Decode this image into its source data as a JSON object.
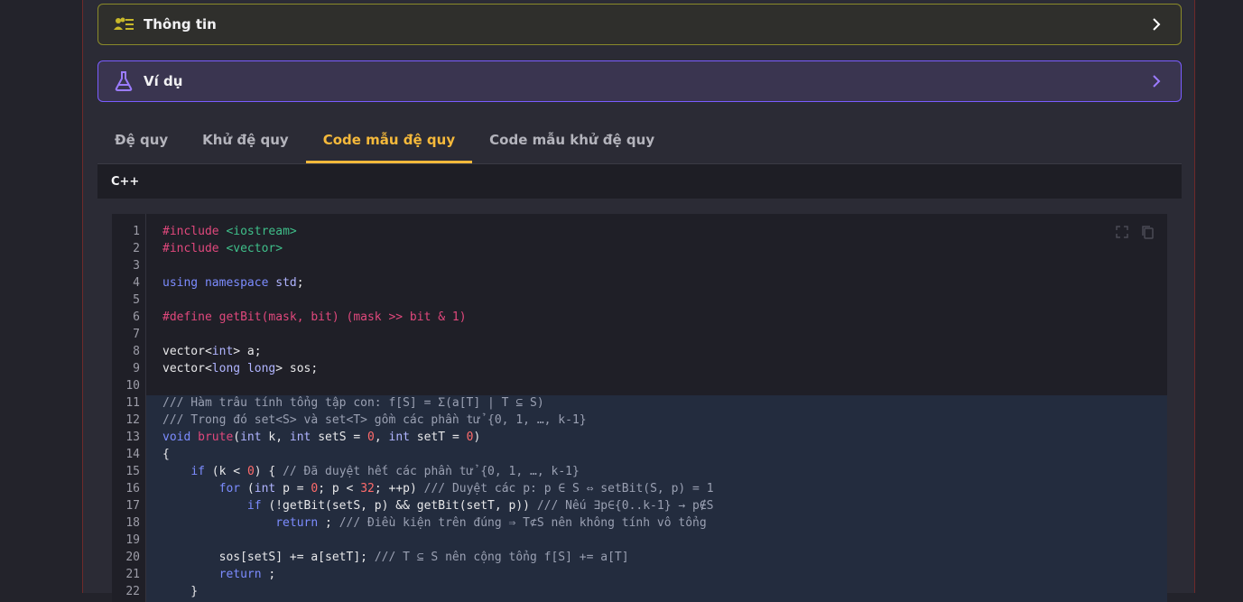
{
  "accordion": {
    "info_title": "Thông tin",
    "example_title": "Ví dụ",
    "info_icon": "users-list-icon",
    "example_icon": "flask-icon"
  },
  "tabs": [
    {
      "label": "Đệ quy",
      "active": false
    },
    {
      "label": "Khử đệ quy",
      "active": false
    },
    {
      "label": "Code mẫu đệ quy",
      "active": true
    },
    {
      "label": "Code mẫu khử đệ quy",
      "active": false
    }
  ],
  "code_language": "C++",
  "code_line_numbers": [
    "1",
    "2",
    "3",
    "4",
    "5",
    "6",
    "7",
    "8",
    "9",
    "10",
    "11",
    "12",
    "13",
    "14",
    "15",
    "16",
    "17",
    "18",
    "19",
    "20",
    "21",
    "22"
  ],
  "code_lines": [
    "#include <iostream>",
    "#include <vector>",
    "",
    "using namespace std;",
    "",
    "#define getBit(mask, bit) (mask >> bit & 1)",
    "",
    "vector<int> a;",
    "vector<long long> sos;",
    "",
    "/// Hàm trâu tính tổng tập con: f[S] = Σ(a[T] | T ⊆ S)",
    "/// Trong đó set<S> và set<T> gồm các phần tử {0, 1, …, k-1}",
    "void brute(int k, int setS = 0, int setT = 0)",
    "{",
    "    if (k < 0) { // Đã duyệt hết các phần tử {0, 1, …, k-1}",
    "        for (int p = 0; p < 32; ++p) /// Duyệt các p: p ∈ S ⇔ setBit(S, p) = 1",
    "            if (!getBit(setS, p) && getBit(setT, p)) /// Nếu ∃p∈{0..k-1} → p∉S",
    "                return ; /// Điều kiện trên đúng ⇒ T⊄S nên không tính vô tổng",
    "",
    "        sos[setS] += a[setT]; /// T ⊆ S nên cộng tổng f[S] += a[T]",
    "        return ;",
    "    }"
  ],
  "colors": {
    "accent": "#f5b93b",
    "info_border": "#8a8a2a",
    "example_border": "#7a5cff"
  }
}
